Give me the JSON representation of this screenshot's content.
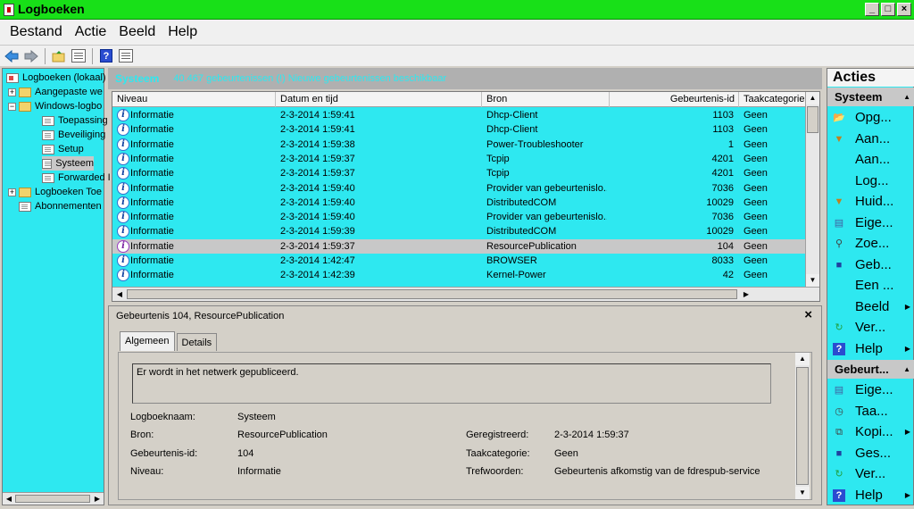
{
  "window": {
    "title": "Logboeken",
    "buttons": [
      "_",
      "□",
      "×"
    ]
  },
  "menu": [
    "Bestand",
    "Actie",
    "Beeld",
    "Help"
  ],
  "toolbar": {
    "help_label": "?"
  },
  "tree": {
    "items": [
      {
        "label": "Logboeken (lokaal)",
        "icon": "logs-icon",
        "expander": ""
      },
      {
        "label": "Aangepaste we",
        "icon": "folder-icon",
        "expander": "+"
      },
      {
        "label": "Windows-logbo",
        "icon": "folder-icon",
        "expander": "−"
      },
      {
        "label": "Toepassing",
        "icon": "log-icon",
        "expander": ""
      },
      {
        "label": "Beveiliging",
        "icon": "log-icon",
        "expander": ""
      },
      {
        "label": "Setup",
        "icon": "log-icon",
        "expander": ""
      },
      {
        "label": "Systeem",
        "icon": "log-icon",
        "expander": "",
        "selected": true
      },
      {
        "label": "Forwarded I",
        "icon": "log-icon",
        "expander": ""
      },
      {
        "label": "Logboeken Toe",
        "icon": "folder-icon",
        "expander": "+"
      },
      {
        "label": "Abonnementen",
        "icon": "log-icon",
        "expander": ""
      }
    ]
  },
  "log_header": {
    "name": "Systeem",
    "count": "40.467 gebeurtenissen (!) Nieuwe gebeurtenissen beschikbaar"
  },
  "events": {
    "columns": [
      "Niveau",
      "Datum en tijd",
      "Bron",
      "Gebeurtenis-id",
      "Taakcategorie"
    ],
    "rows": [
      {
        "level": "Informatie",
        "date": "2-3-2014 1:59:41",
        "source": "Dhcp-Client",
        "id": "1103",
        "category": "Geen"
      },
      {
        "level": "Informatie",
        "date": "2-3-2014 1:59:41",
        "source": "Dhcp-Client",
        "id": "1103",
        "category": "Geen"
      },
      {
        "level": "Informatie",
        "date": "2-3-2014 1:59:38",
        "source": "Power-Troubleshooter",
        "id": "1",
        "category": "Geen"
      },
      {
        "level": "Informatie",
        "date": "2-3-2014 1:59:37",
        "source": "Tcpip",
        "id": "4201",
        "category": "Geen"
      },
      {
        "level": "Informatie",
        "date": "2-3-2014 1:59:37",
        "source": "Tcpip",
        "id": "4201",
        "category": "Geen"
      },
      {
        "level": "Informatie",
        "date": "2-3-2014 1:59:40",
        "source": "Provider van gebeurtenislo...",
        "id": "7036",
        "category": "Geen"
      },
      {
        "level": "Informatie",
        "date": "2-3-2014 1:59:40",
        "source": "DistributedCOM",
        "id": "10029",
        "category": "Geen"
      },
      {
        "level": "Informatie",
        "date": "2-3-2014 1:59:40",
        "source": "Provider van gebeurtenislo...",
        "id": "7036",
        "category": "Geen"
      },
      {
        "level": "Informatie",
        "date": "2-3-2014 1:59:39",
        "source": "DistributedCOM",
        "id": "10029",
        "category": "Geen"
      },
      {
        "level": "Informatie",
        "date": "2-3-2014 1:59:37",
        "source": "ResourcePublication",
        "id": "104",
        "category": "Geen",
        "selected": true
      },
      {
        "level": "Informatie",
        "date": "2-3-2014 1:42:47",
        "source": "BROWSER",
        "id": "8033",
        "category": "Geen"
      },
      {
        "level": "Informatie",
        "date": "2-3-2014 1:42:39",
        "source": "Kernel-Power",
        "id": "42",
        "category": "Geen"
      }
    ]
  },
  "details": {
    "title": "Gebeurtenis 104, ResourcePublication",
    "tabs": [
      "Algemeen",
      "Details"
    ],
    "description": "Er wordt in het netwerk gepubliceerd.",
    "fields": {
      "logname_label": "Logboeknaam:",
      "logname": "Systeem",
      "source_label": "Bron:",
      "source": "ResourcePublication",
      "registered_label": "Geregistreerd:",
      "registered": "2-3-2014 1:59:37",
      "id_label": "Gebeurtenis-id:",
      "id": "104",
      "category_label": "Taakcategorie:",
      "category": "Geen",
      "level_label": "Niveau:",
      "level": "Informatie",
      "keywords_label": "Trefwoorden:",
      "keywords": "Gebeurtenis afkomstig van de fdrespub-service"
    }
  },
  "actions": {
    "title": "Acties",
    "section1": "Systeem",
    "items1": [
      {
        "label": "Opg...",
        "icon": "open-folder-icon"
      },
      {
        "label": "Aan...",
        "icon": "filter-icon"
      },
      {
        "label": "Aan...",
        "icon": ""
      },
      {
        "label": "Log...",
        "icon": ""
      },
      {
        "label": "Huid...",
        "icon": "filter-icon"
      },
      {
        "label": "Eige...",
        "icon": "properties-icon"
      },
      {
        "label": "Zoe...",
        "icon": "find-icon"
      },
      {
        "label": "Geb...",
        "icon": "save-icon"
      },
      {
        "label": "Een ...",
        "icon": ""
      },
      {
        "label": "Beeld",
        "icon": "",
        "submenu": true
      },
      {
        "label": "Ver...",
        "icon": "refresh-icon"
      },
      {
        "label": "Help",
        "icon": "help-icon",
        "submenu": true
      }
    ],
    "section2": "Gebeurt...",
    "items2": [
      {
        "label": "Eige...",
        "icon": "properties-icon"
      },
      {
        "label": "Taa...",
        "icon": "task-icon"
      },
      {
        "label": "Kopi...",
        "icon": "copy-icon",
        "submenu": true
      },
      {
        "label": "Ges...",
        "icon": "save-icon"
      },
      {
        "label": "Ver...",
        "icon": "refresh-icon"
      },
      {
        "label": "Help",
        "icon": "help-icon",
        "submenu": true
      }
    ]
  }
}
